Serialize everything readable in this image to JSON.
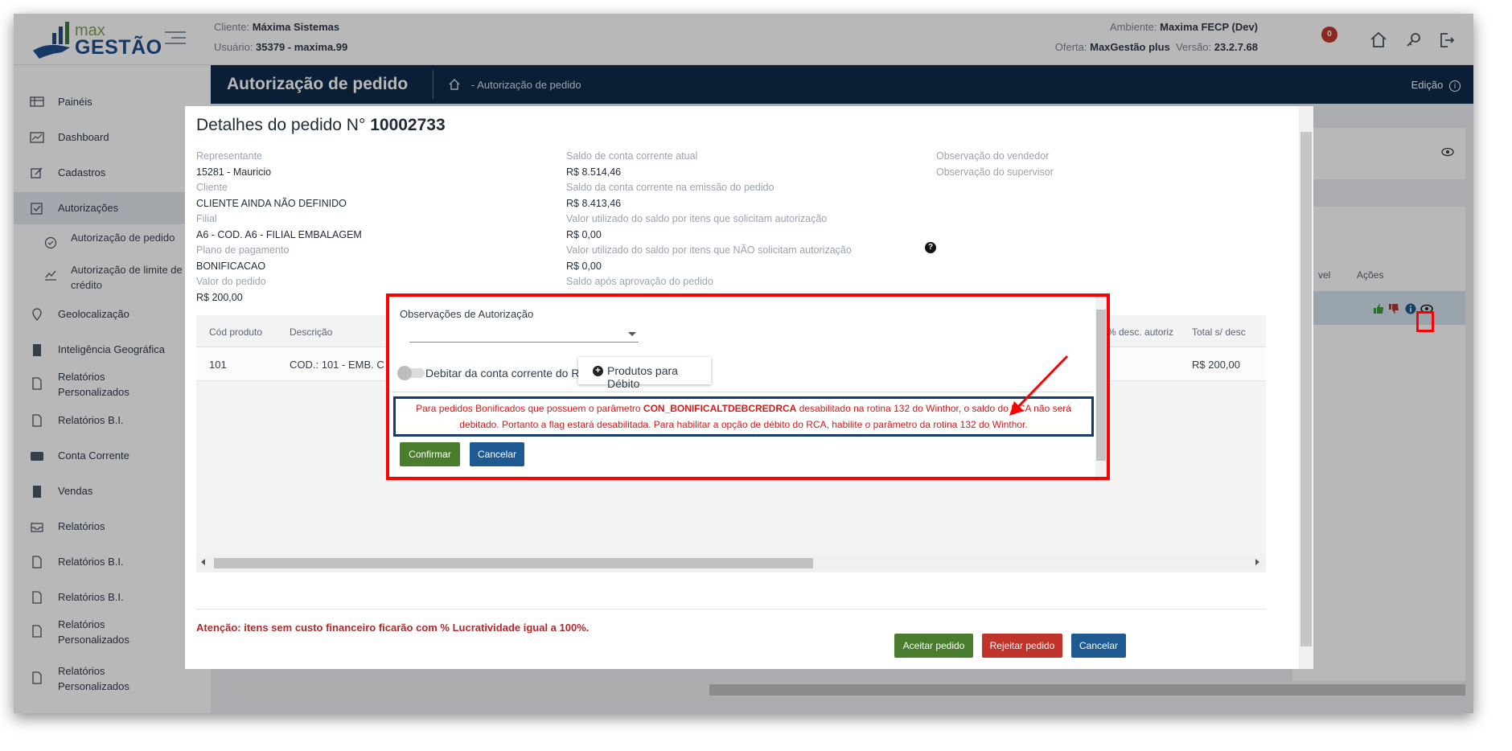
{
  "header": {
    "logo_small": "max",
    "logo_big": "GESTÃO",
    "client_label": "Cliente:",
    "client_value": "Máxima Sistemas",
    "user_label": "Usuário:",
    "user_value": "35379 - maxima.99",
    "env_label": "Ambiente:",
    "env_value": "Maxima FECP (Dev)",
    "offer_label": "Oferta:",
    "offer_value": "MaxGestão plus",
    "version_label": "Versão:",
    "version_value": "23.2.7.68",
    "notifications": "0"
  },
  "titlebar": {
    "title": "Autorização de pedido",
    "breadcrumb": "- Autorização de pedido",
    "edit_label": "Edição"
  },
  "sidebar": {
    "items": [
      {
        "label": "Painéis"
      },
      {
        "label": "Dashboard"
      },
      {
        "label": "Cadastros"
      },
      {
        "label": "Autorizações"
      },
      {
        "label": "Geolocalização"
      },
      {
        "label": "Inteligência Geográfica"
      },
      {
        "label": "Relatórios Personalizados"
      },
      {
        "label": "Relatórios B.I."
      },
      {
        "label": "Conta Corrente"
      },
      {
        "label": "Vendas"
      },
      {
        "label": "Relatórios"
      },
      {
        "label": "Relatórios B.I."
      },
      {
        "label": "Relatórios B.I."
      },
      {
        "label": "Relatórios Personalizados"
      },
      {
        "label": "Relatórios Personalizados"
      }
    ],
    "sub": [
      {
        "label": "Autorização de pedido"
      },
      {
        "label": "Autorização de limite de crédito"
      }
    ]
  },
  "background": {
    "col_level": "vel",
    "col_actions": "Ações"
  },
  "details": {
    "title_prefix": "Detalhes do pedido N°",
    "order_number": "10002733",
    "col1": [
      {
        "label": "Representante",
        "value": "15281 - Mauricio"
      },
      {
        "label": "Cliente",
        "value": "CLIENTE AINDA NÃO DEFINIDO"
      },
      {
        "label": "Filial",
        "value": "A6 - COD. A6 - FILIAL EMBALAGEM"
      },
      {
        "label": "Plano de pagamento",
        "value": "BONIFICACAO"
      },
      {
        "label": "Valor do pedido",
        "value": "R$ 200,00"
      }
    ],
    "col2": [
      {
        "label": "Saldo de conta corrente atual",
        "value": "R$ 8.514,46"
      },
      {
        "label": "Saldo da conta corrente na emissão do pedido",
        "value": "R$ 8.413,46"
      },
      {
        "label": "Valor utilizado do saldo por itens que solicitam autorização",
        "value": "R$ 0,00"
      },
      {
        "label": "Valor utilizado do saldo por itens que NÃO solicitam autorização",
        "value": "R$ 0,00"
      },
      {
        "label": "Saldo após aprovação do pedido",
        "value": ""
      }
    ],
    "col3": [
      {
        "label": "Observação do vendedor"
      },
      {
        "label": "Observação do supervisor"
      }
    ],
    "table": {
      "headers": {
        "code": "Cód produto",
        "desc": "Descrição",
        "disc": "% desc. autoriz",
        "total": "Total s/ desc"
      },
      "row": {
        "code": "101",
        "desc": "COD.: 101 - EMB. C",
        "total": "R$ 200,00"
      }
    },
    "attention": "Atenção: itens sem custo financeiro ficarão com % Lucratividade igual a 100%.",
    "btn_accept": "Aceitar pedido",
    "btn_reject": "Rejeitar pedido",
    "btn_cancel": "Cancelar"
  },
  "auth_dialog": {
    "title": "Observações de Autorização",
    "toggle_label": "Debitar da conta corrente do RCA",
    "products_button": "Produtos para Débito",
    "msg_part1": "Para pedidos Bonificados que possuem o parâmetro ",
    "msg_param": "CON_BONIFICALTDEBCREDRCA",
    "msg_part2": " desabilitado na rotina 132 do Winthor, o saldo do RCA não será debitado. Portanto a flag estará desabilitada. Para habilitar a opção de débito do RCA, habilite o parâmetro da rotina 132 do Winthor.",
    "btn_confirm": "Confirmar",
    "btn_cancel": "Cancelar"
  },
  "colors": {
    "navy": "#0f2a4a",
    "green": "#4a7c2e",
    "red": "#c0332b",
    "blue": "#1e5a91",
    "alert": "#ff0000"
  }
}
